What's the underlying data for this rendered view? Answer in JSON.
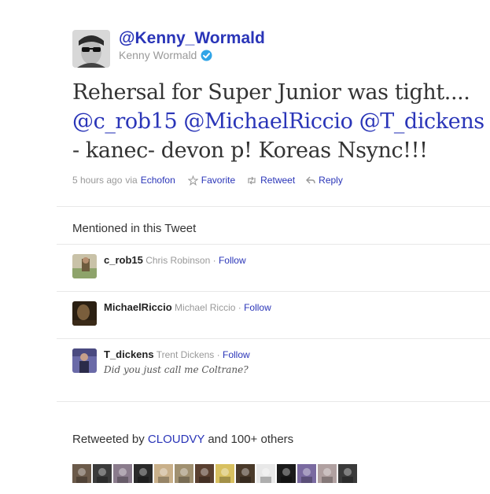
{
  "header": {
    "screen_name": "@Kenny_Wormald",
    "full_name": "Kenny Wormald",
    "verified": true
  },
  "tweet": {
    "text_parts": [
      {
        "text": "Rehersal for Super Junior was tight.... ",
        "type": "text"
      },
      {
        "text": "@c_rob15",
        "type": "mention"
      },
      {
        "text": " ",
        "type": "text"
      },
      {
        "text": "@MichaelRiccio",
        "type": "mention"
      },
      {
        "text": " ",
        "type": "text"
      },
      {
        "text": "@T_dickens",
        "type": "mention"
      },
      {
        "text": " - kanec- devon p! Koreas Nsync!!!",
        "type": "text"
      }
    ],
    "time_ago": "5 hours ago",
    "via_label": "via",
    "via_app": "Echofon",
    "actions": {
      "favorite": "Favorite",
      "retweet": "Retweet",
      "reply": "Reply"
    }
  },
  "mentioned": {
    "heading": "Mentioned in this Tweet",
    "follow_label": "Follow",
    "separator": "·",
    "users": [
      {
        "screen_name": "c_rob15",
        "name": "Chris Robinson",
        "bio": ""
      },
      {
        "screen_name": "MichaelRiccio",
        "name": "Michael Riccio",
        "bio": ""
      },
      {
        "screen_name": "T_dickens",
        "name": "Trent Dickens",
        "bio": "Did you just call me Coltrane?"
      }
    ]
  },
  "retweets": {
    "prefix": "Retweeted by",
    "user": "CLOUDVY",
    "suffix": "and 100+ others",
    "avatar_count": 14
  },
  "colors": {
    "link": "#2a35b8",
    "muted": "#999999",
    "text": "#333333"
  }
}
